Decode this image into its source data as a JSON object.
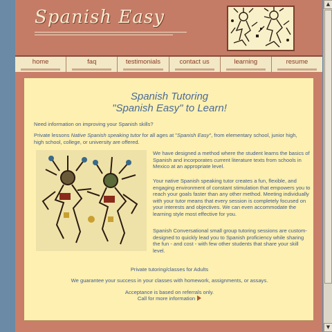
{
  "site": {
    "logo_text": "Spanish Easy"
  },
  "nav": {
    "items": [
      {
        "label": "home"
      },
      {
        "label": "faq"
      },
      {
        "label": "testimonials"
      },
      {
        "label": "contact us"
      },
      {
        "label": "learning"
      },
      {
        "label": "resume"
      }
    ]
  },
  "main": {
    "title_line1": "Spanish Tutoring",
    "title_line2": "\"Spanish Easy\" to Learn!",
    "intro_question": "Need information on improving your Spanish skills?",
    "private_lessons_a": "Private lessons ",
    "private_lessons_b": "Native Spanish speaking tutor",
    "private_lessons_c": " for all ages at \"",
    "private_lessons_d": "Spanish Easy",
    "private_lessons_e": "\", from elementary school, junior high, high school, college, or university are offered.",
    "para_method": "We have designed a method where the student learns the basics of Spanish and incorporates current literature texts from schools in Mexico at an appropriate level.",
    "para_tutor": "Your native Spanish speaking tutor creates a fun, flexible, and engaging environment of constant stimulation that empowers you to reach your goals faster than any other method. Meeting individually with your tutor means that every session is completely focused on your interests and objectives. We can even accommodate the learning style most effective for you.",
    "para_groups": "Spanish Conversational small group tutoring sessions are custom-designed to quickly lead you to Spanish proficiency while sharing the fun - and cost - with few other students that share your skill level.",
    "adults": "Private tutoring/classes for Adults",
    "guarantee": "We guarantee your success in your classes with homework, assignments, or assays.",
    "acceptance": "Acceptance is based on referrals only.",
    "call_link": "Call for more information"
  },
  "colors": {
    "banner": "#c47c66",
    "content_bg": "#fdf0b0",
    "text_blue": "#3e5a8c",
    "nav_text": "#8a3a22",
    "page_bg": "#6b8aa6"
  },
  "icons": {
    "emblem": "aztec-figures-emblem",
    "illustration": "aztec-warriors-illustration",
    "call_arrow": "right-arrow-icon"
  }
}
